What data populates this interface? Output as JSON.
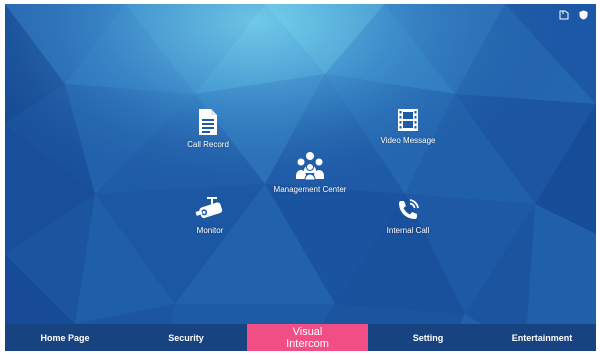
{
  "apps": {
    "call_record": {
      "label": "Call Record",
      "icon": "document-icon"
    },
    "video_message": {
      "label": "Video Message",
      "icon": "film-icon"
    },
    "management_center": {
      "label": "Management Center",
      "icon": "people-icon"
    },
    "monitor": {
      "label": "Monitor",
      "icon": "camera-icon"
    },
    "internal_call": {
      "label": "Internal Call",
      "icon": "phone-icon"
    }
  },
  "status_bar": {
    "icons": [
      "sd-card-icon",
      "shield-icon"
    ]
  },
  "navbar": {
    "tabs": [
      {
        "label": "Home Page",
        "active": false
      },
      {
        "label": "Security",
        "active": false
      },
      {
        "label": "Visual Intercom",
        "active": true
      },
      {
        "label": "Setting",
        "active": false
      },
      {
        "label": "Entertainment",
        "active": false
      }
    ]
  },
  "colors": {
    "background": "#1f5aa8",
    "active_tab": "#f04e84",
    "navbar": "#1e4d8c",
    "text": "#ffffff"
  }
}
